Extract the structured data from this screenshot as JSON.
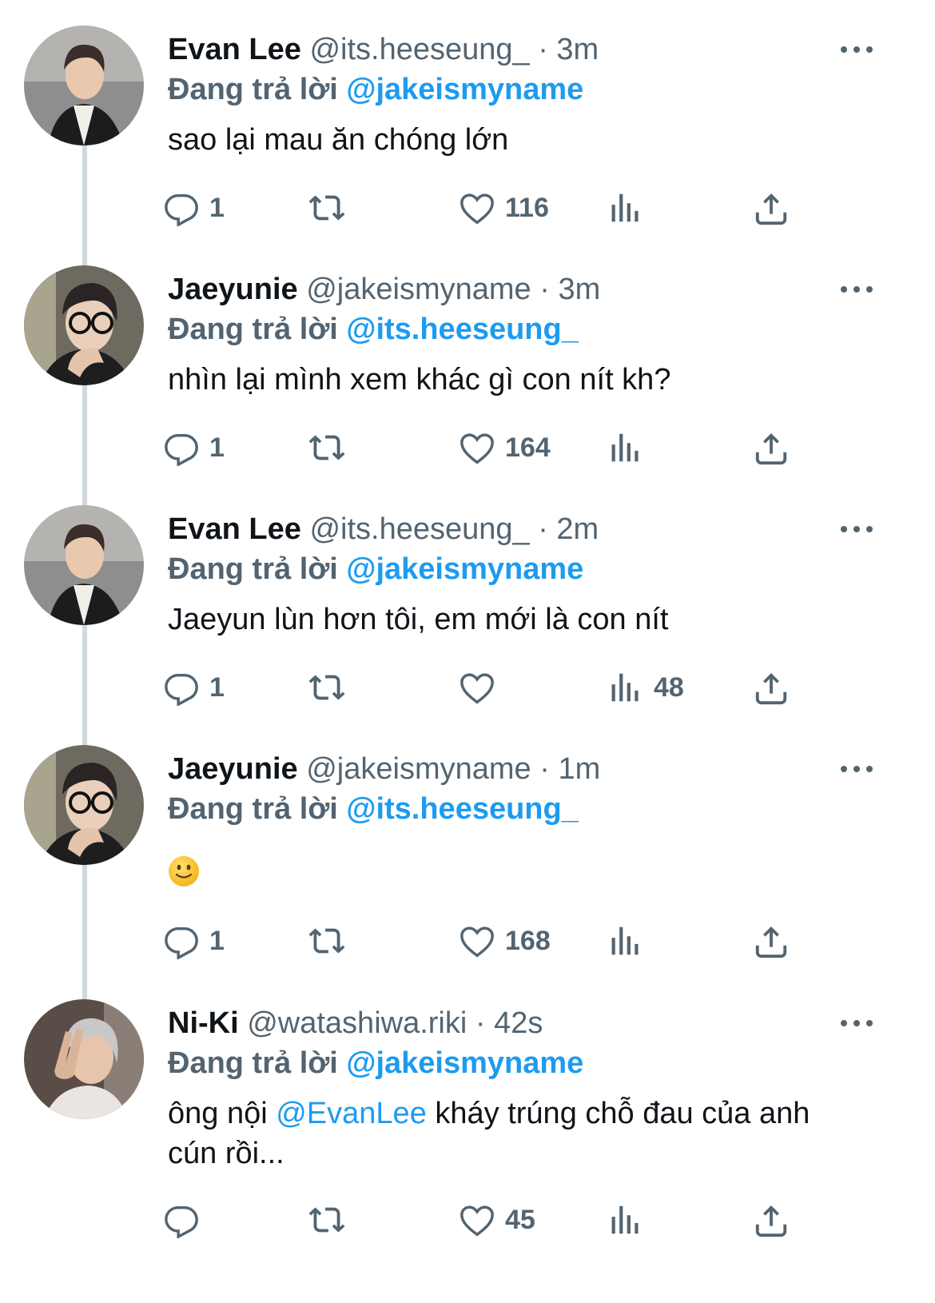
{
  "colors": {
    "link": "#1d9bf0",
    "secondary_text": "#536471",
    "primary_text": "#0f1419",
    "thread_line": "#cfd9de"
  },
  "tweets": [
    {
      "display_name": "Evan Lee",
      "handle": "@its.heeseung_",
      "dot": "·",
      "time": "3m",
      "reply_prefix": "Đang trả lời",
      "reply_to": "@jakeismyname",
      "text_before": "sao lại mau ăn chóng lớn",
      "mention": "",
      "text_after": "",
      "avatar": "avatar-evan-lee",
      "reply_count": "1",
      "retweet_count": "",
      "like_count": "116",
      "view_count": ""
    },
    {
      "display_name": "Jaeyunie",
      "handle": "@jakeismyname",
      "dot": "·",
      "time": "3m",
      "reply_prefix": "Đang trả lời",
      "reply_to": "@its.heeseung_",
      "text_before": "nhìn lại mình xem khác gì con nít kh?",
      "mention": "",
      "text_after": "",
      "avatar": "avatar-jaeyunie",
      "reply_count": "1",
      "retweet_count": "",
      "like_count": "164",
      "view_count": ""
    },
    {
      "display_name": "Evan Lee",
      "handle": "@its.heeseung_",
      "dot": "·",
      "time": "2m",
      "reply_prefix": "Đang trả lời",
      "reply_to": "@jakeismyname",
      "text_before": "Jaeyun lùn hơn tôi, em mới là con nít",
      "mention": "",
      "text_after": "",
      "avatar": "avatar-evan-lee",
      "reply_count": "1",
      "retweet_count": "",
      "like_count": "",
      "view_count": "48"
    },
    {
      "display_name": "Jaeyunie",
      "handle": "@jakeismyname",
      "dot": "·",
      "time": "1m",
      "reply_prefix": "Đang trả lời",
      "reply_to": "@its.heeseung_",
      "text_before": "",
      "mention": "",
      "text_after": "",
      "emoji": "slightly-smiling-face-emoji",
      "avatar": "avatar-jaeyunie",
      "reply_count": "1",
      "retweet_count": "",
      "like_count": "168",
      "view_count": ""
    },
    {
      "display_name": "Ni-Ki",
      "handle": "@watashiwa.riki",
      "dot": "·",
      "time": "42s",
      "reply_prefix": "Đang trả lời",
      "reply_to": "@jakeismyname",
      "text_before": "ông nội ",
      "mention": "@EvanLee",
      "text_after": " kháy trúng chỗ đau của anh cún rồi...",
      "avatar": "avatar-ni-ki",
      "reply_count": "",
      "retweet_count": "",
      "like_count": "45",
      "view_count": ""
    }
  ],
  "icons": {
    "reply": "reply-icon",
    "retweet": "retweet-icon",
    "like": "heart-icon",
    "views": "views-icon",
    "share": "share-icon",
    "more": "more-icon"
  }
}
